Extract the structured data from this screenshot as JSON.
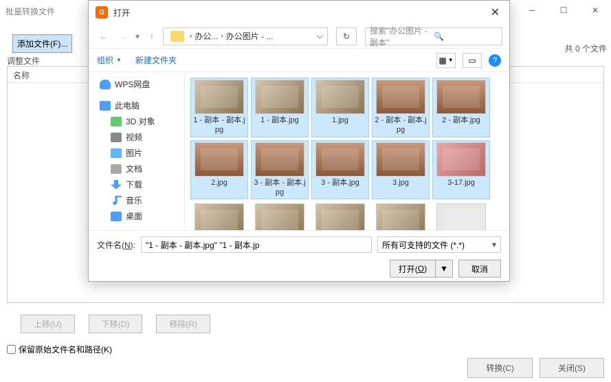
{
  "bg": {
    "title": "批量转换文件",
    "add_file": "添加文件(F)...",
    "adjust": "调整文件",
    "name_col": "名称",
    "file_count": "共 0 个文件",
    "move_up": "上移(U)",
    "move_down": "下移(D)",
    "remove": "移除(R)",
    "keep_path": "保留原始文件名和路径(K)",
    "convert": "转换(C)",
    "close": "关闭(S)"
  },
  "dlg": {
    "title": "打开",
    "bc1": "办公...",
    "bc2": "办公图片 - ...",
    "search_ph": "搜索\"办公图片 - 副本\"",
    "organize": "组织",
    "new_folder": "新建文件夹",
    "tree": {
      "wps": "WPS网盘",
      "pc": "此电脑",
      "d3": "3D 对象",
      "video": "视频",
      "pic": "图片",
      "doc": "文档",
      "dl": "下载",
      "music": "音乐",
      "desk": "桌面"
    },
    "files": [
      {
        "n": "1 - 副本 - 副本.jpg",
        "sel": true,
        "c": ""
      },
      {
        "n": "1 - 副本.jpg",
        "sel": true,
        "c": ""
      },
      {
        "n": "1.jpg",
        "sel": true,
        "c": ""
      },
      {
        "n": "2 - 副本 - 副本.jpg",
        "sel": true,
        "c": "books"
      },
      {
        "n": "2 - 副本.jpg",
        "sel": true,
        "c": "books"
      },
      {
        "n": "2.jpg",
        "sel": true,
        "c": "books"
      },
      {
        "n": "3 - 副本 - 副本.jpg",
        "sel": true,
        "c": "books"
      },
      {
        "n": "3 - 副本.jpg",
        "sel": true,
        "c": "books"
      },
      {
        "n": "3.jpg",
        "sel": true,
        "c": "books"
      },
      {
        "n": "3-17.jpg",
        "sel": true,
        "c": "person"
      },
      {
        "n": "",
        "sel": false,
        "c": ""
      },
      {
        "n": "",
        "sel": false,
        "c": ""
      },
      {
        "n": "",
        "sel": false,
        "c": ""
      },
      {
        "n": "",
        "sel": false,
        "c": ""
      },
      {
        "n": "",
        "sel": false,
        "c": "frame"
      }
    ],
    "fn_label_pre": "文件名(",
    "fn_label_u": "N",
    "fn_label_post": "):",
    "fn_value": "\"1 - 副本 - 副本.jpg\" \"1 - 副本.jp",
    "filter": "所有可支持的文件 (*.*)",
    "open_pre": "打开(",
    "open_u": "O",
    "open_post": ")",
    "cancel": "取消"
  }
}
